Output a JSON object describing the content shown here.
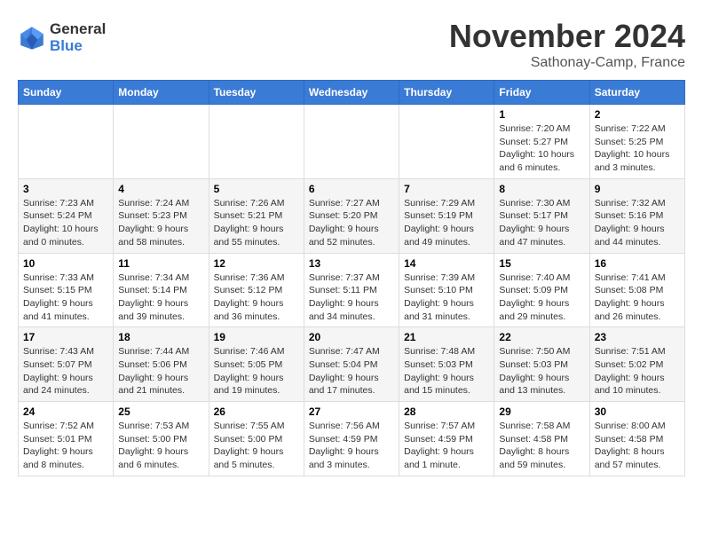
{
  "logo": {
    "general": "General",
    "blue": "Blue"
  },
  "header": {
    "month": "November 2024",
    "location": "Sathonay-Camp, France"
  },
  "weekdays": [
    "Sunday",
    "Monday",
    "Tuesday",
    "Wednesday",
    "Thursday",
    "Friday",
    "Saturday"
  ],
  "weeks": [
    [
      {
        "day": "",
        "info": ""
      },
      {
        "day": "",
        "info": ""
      },
      {
        "day": "",
        "info": ""
      },
      {
        "day": "",
        "info": ""
      },
      {
        "day": "",
        "info": ""
      },
      {
        "day": "1",
        "info": "Sunrise: 7:20 AM\nSunset: 5:27 PM\nDaylight: 10 hours\nand 6 minutes."
      },
      {
        "day": "2",
        "info": "Sunrise: 7:22 AM\nSunset: 5:25 PM\nDaylight: 10 hours\nand 3 minutes."
      }
    ],
    [
      {
        "day": "3",
        "info": "Sunrise: 7:23 AM\nSunset: 5:24 PM\nDaylight: 10 hours\nand 0 minutes."
      },
      {
        "day": "4",
        "info": "Sunrise: 7:24 AM\nSunset: 5:23 PM\nDaylight: 9 hours\nand 58 minutes."
      },
      {
        "day": "5",
        "info": "Sunrise: 7:26 AM\nSunset: 5:21 PM\nDaylight: 9 hours\nand 55 minutes."
      },
      {
        "day": "6",
        "info": "Sunrise: 7:27 AM\nSunset: 5:20 PM\nDaylight: 9 hours\nand 52 minutes."
      },
      {
        "day": "7",
        "info": "Sunrise: 7:29 AM\nSunset: 5:19 PM\nDaylight: 9 hours\nand 49 minutes."
      },
      {
        "day": "8",
        "info": "Sunrise: 7:30 AM\nSunset: 5:17 PM\nDaylight: 9 hours\nand 47 minutes."
      },
      {
        "day": "9",
        "info": "Sunrise: 7:32 AM\nSunset: 5:16 PM\nDaylight: 9 hours\nand 44 minutes."
      }
    ],
    [
      {
        "day": "10",
        "info": "Sunrise: 7:33 AM\nSunset: 5:15 PM\nDaylight: 9 hours\nand 41 minutes."
      },
      {
        "day": "11",
        "info": "Sunrise: 7:34 AM\nSunset: 5:14 PM\nDaylight: 9 hours\nand 39 minutes."
      },
      {
        "day": "12",
        "info": "Sunrise: 7:36 AM\nSunset: 5:12 PM\nDaylight: 9 hours\nand 36 minutes."
      },
      {
        "day": "13",
        "info": "Sunrise: 7:37 AM\nSunset: 5:11 PM\nDaylight: 9 hours\nand 34 minutes."
      },
      {
        "day": "14",
        "info": "Sunrise: 7:39 AM\nSunset: 5:10 PM\nDaylight: 9 hours\nand 31 minutes."
      },
      {
        "day": "15",
        "info": "Sunrise: 7:40 AM\nSunset: 5:09 PM\nDaylight: 9 hours\nand 29 minutes."
      },
      {
        "day": "16",
        "info": "Sunrise: 7:41 AM\nSunset: 5:08 PM\nDaylight: 9 hours\nand 26 minutes."
      }
    ],
    [
      {
        "day": "17",
        "info": "Sunrise: 7:43 AM\nSunset: 5:07 PM\nDaylight: 9 hours\nand 24 minutes."
      },
      {
        "day": "18",
        "info": "Sunrise: 7:44 AM\nSunset: 5:06 PM\nDaylight: 9 hours\nand 21 minutes."
      },
      {
        "day": "19",
        "info": "Sunrise: 7:46 AM\nSunset: 5:05 PM\nDaylight: 9 hours\nand 19 minutes."
      },
      {
        "day": "20",
        "info": "Sunrise: 7:47 AM\nSunset: 5:04 PM\nDaylight: 9 hours\nand 17 minutes."
      },
      {
        "day": "21",
        "info": "Sunrise: 7:48 AM\nSunset: 5:03 PM\nDaylight: 9 hours\nand 15 minutes."
      },
      {
        "day": "22",
        "info": "Sunrise: 7:50 AM\nSunset: 5:03 PM\nDaylight: 9 hours\nand 13 minutes."
      },
      {
        "day": "23",
        "info": "Sunrise: 7:51 AM\nSunset: 5:02 PM\nDaylight: 9 hours\nand 10 minutes."
      }
    ],
    [
      {
        "day": "24",
        "info": "Sunrise: 7:52 AM\nSunset: 5:01 PM\nDaylight: 9 hours\nand 8 minutes."
      },
      {
        "day": "25",
        "info": "Sunrise: 7:53 AM\nSunset: 5:00 PM\nDaylight: 9 hours\nand 6 minutes."
      },
      {
        "day": "26",
        "info": "Sunrise: 7:55 AM\nSunset: 5:00 PM\nDaylight: 9 hours\nand 5 minutes."
      },
      {
        "day": "27",
        "info": "Sunrise: 7:56 AM\nSunset: 4:59 PM\nDaylight: 9 hours\nand 3 minutes."
      },
      {
        "day": "28",
        "info": "Sunrise: 7:57 AM\nSunset: 4:59 PM\nDaylight: 9 hours\nand 1 minute."
      },
      {
        "day": "29",
        "info": "Sunrise: 7:58 AM\nSunset: 4:58 PM\nDaylight: 8 hours\nand 59 minutes."
      },
      {
        "day": "30",
        "info": "Sunrise: 8:00 AM\nSunset: 4:58 PM\nDaylight: 8 hours\nand 57 minutes."
      }
    ]
  ]
}
